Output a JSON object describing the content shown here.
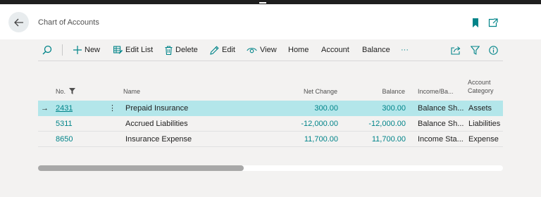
{
  "header": {
    "title": "Chart of Accounts",
    "back_icon": "arrow-left-icon",
    "bookmark_icon": "bookmark-icon",
    "open_in_new_icon": "open-in-new-window-icon"
  },
  "toolbar": {
    "search_icon": "search-icon",
    "actions": [
      {
        "label": "New",
        "icon": "plus-icon"
      },
      {
        "label": "Edit List",
        "icon": "edit-list-icon"
      },
      {
        "label": "Delete",
        "icon": "trash-icon"
      },
      {
        "label": "Edit",
        "icon": "pencil-icon"
      },
      {
        "label": "View",
        "icon": "eye-icon"
      },
      {
        "label": "Home"
      },
      {
        "label": "Account"
      },
      {
        "label": "Balance"
      }
    ],
    "more": "···",
    "share_icon": "share-icon",
    "filter_icon": "filter-icon",
    "info_icon": "info-icon"
  },
  "table": {
    "columns": {
      "no": "No.",
      "name": "Name",
      "net_change": "Net Change",
      "balance": "Balance",
      "income_balance": "Income/Ba...",
      "account_category_1": "Account",
      "account_category_2": "Category"
    },
    "rows": [
      {
        "no": "2431",
        "name": "Prepaid Insurance",
        "net_change": "300.00",
        "balance": "300.00",
        "income_balance": "Balance Sh...",
        "category": "Assets"
      },
      {
        "no": "5311",
        "name": "Accrued Liabilities",
        "net_change": "-12,000.00",
        "balance": "-12,000.00",
        "income_balance": "Balance Sh...",
        "category": "Liabilities"
      },
      {
        "no": "8650",
        "name": "Insurance Expense",
        "net_change": "11,700.00",
        "balance": "11,700.00",
        "income_balance": "Income Sta...",
        "category": "Expense"
      }
    ],
    "selected_row": 0,
    "row_menu": "⋮",
    "row_arrow": "→"
  },
  "colors": {
    "accent": "#008489",
    "selected_row": "#b3e6ea",
    "background": "#f3f2f1"
  }
}
